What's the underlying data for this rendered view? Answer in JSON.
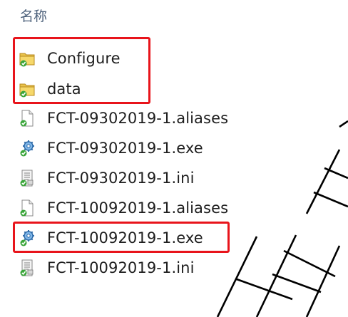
{
  "header": {
    "name_column": "名称"
  },
  "files": [
    {
      "name": "Configure",
      "icon": "folder-icon"
    },
    {
      "name": "data",
      "icon": "folder-icon"
    },
    {
      "name": "FCT-09302019-1.aliases",
      "icon": "generic-file-icon"
    },
    {
      "name": "FCT-09302019-1.exe",
      "icon": "exe-gear-icon"
    },
    {
      "name": "FCT-09302019-1.ini",
      "icon": "ini-settings-icon"
    },
    {
      "name": "FCT-10092019-1.aliases",
      "icon": "generic-file-icon"
    },
    {
      "name": "FCT-10092019-1.exe",
      "icon": "exe-gear-icon"
    },
    {
      "name": "FCT-10092019-1.ini",
      "icon": "ini-settings-icon"
    }
  ],
  "colors": {
    "highlight": "#e8141b",
    "header_text": "#4c607a",
    "check_badge": "#3aa53a"
  }
}
